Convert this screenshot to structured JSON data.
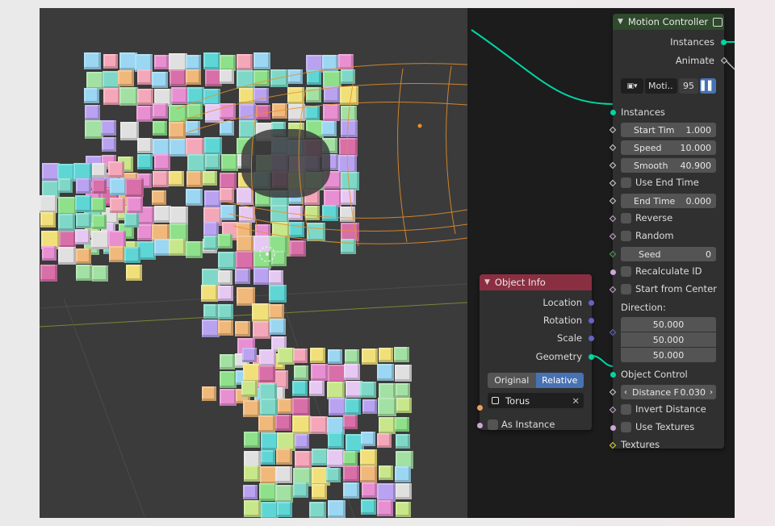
{
  "motion_node": {
    "title": "Motion Controller",
    "outputs": [
      "Instances",
      "Animate"
    ],
    "header_field": {
      "name": "Moti..",
      "users": "95"
    },
    "inputs": {
      "instances": "Instances",
      "start_time": {
        "label": "Start Tim",
        "value": "1.000"
      },
      "speed": {
        "label": "Speed",
        "value": "10.000"
      },
      "smooth": {
        "label": "Smooth",
        "value": "40.900"
      },
      "use_end_time": "Use End Time",
      "end_time": {
        "label": "End Time",
        "value": "0.000"
      },
      "reverse": "Reverse",
      "random": "Random",
      "seed": {
        "label": "Seed",
        "value": "0"
      },
      "recalculate_id": "Recalculate ID",
      "start_from_center": "Start from Center",
      "direction_label": "Direction:",
      "direction": [
        "50.000",
        "50.000",
        "50.000"
      ],
      "object_control": "Object Control",
      "distance": {
        "label": "Distance F",
        "value": "0.030"
      },
      "invert_distance": "Invert Distance",
      "use_textures": "Use Textures",
      "textures": "Textures"
    }
  },
  "object_info_node": {
    "title": "Object Info",
    "outputs": [
      "Location",
      "Rotation",
      "Scale",
      "Geometry"
    ],
    "transform_space": {
      "options": [
        "Original",
        "Relative"
      ],
      "selected": "Relative"
    },
    "object": "Torus",
    "as_instance": "As Instance"
  },
  "colors": {
    "motion_header": "#2f4a2c",
    "object_info_header": "#8a2f42",
    "geometry_socket": "#00d6a3",
    "vector_socket": "#6363c7",
    "float_socket": "#a1a1a1",
    "boolean_socket": "#cca6d6",
    "object_socket": "#ed9e5c",
    "relative_active": "#4772b3",
    "wireframe": "#e8902a"
  }
}
